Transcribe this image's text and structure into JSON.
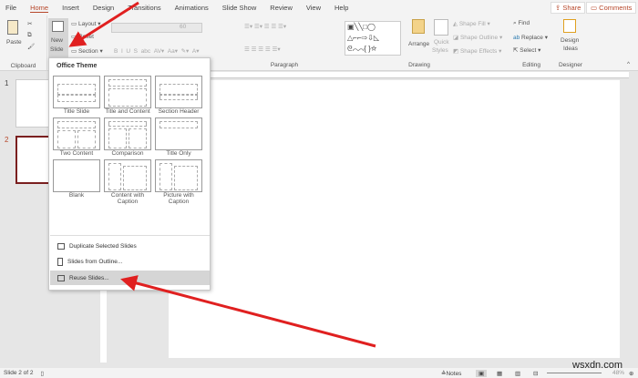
{
  "tabs": [
    "File",
    "Home",
    "Insert",
    "Design",
    "Transitions",
    "Animations",
    "Slide Show",
    "Review",
    "View",
    "Help"
  ],
  "share": "Share",
  "comments": "Comments",
  "ribbon": {
    "paste": "Paste",
    "new_slide_1": "New",
    "new_slide_2": "Slide",
    "layout": "Layout",
    "reset": "Reset",
    "section": "Section",
    "clipboard": "Clipboard",
    "paragraph": "Paragraph",
    "font_size": "60",
    "drawing": "Drawing",
    "arrange": "Arrange",
    "quick_styles_1": "Quick",
    "quick_styles_2": "Styles",
    "shape_fill": "Shape Fill",
    "shape_outline": "Shape Outline",
    "shape_effects": "Shape Effects",
    "find": "Find",
    "replace": "Replace",
    "select": "Select",
    "editing": "Editing",
    "design_ideas_1": "Design",
    "design_ideas_2": "Ideas",
    "designer": "Designer"
  },
  "slides": [
    "1",
    "2"
  ],
  "menu": {
    "header": "Office Theme",
    "layouts": [
      [
        "Title Slide"
      ],
      [
        "Title and Content"
      ],
      [
        "Section Header"
      ],
      [
        "Two Content"
      ],
      [
        "Comparison"
      ],
      [
        "Title Only"
      ],
      [
        "Blank"
      ],
      [
        "Content with",
        "Caption"
      ],
      [
        "Picture with",
        "Caption"
      ]
    ],
    "items": [
      "Duplicate Selected Slides",
      "Slides from Outline...",
      "Reuse Slides..."
    ]
  },
  "status": {
    "slide": "Slide 2 of 2",
    "notes": "Notes",
    "zoom": "48%",
    "watermark": "wsxdn.com"
  },
  "colors": {
    "accent": "#b7472a",
    "arrow": "#e02020"
  }
}
